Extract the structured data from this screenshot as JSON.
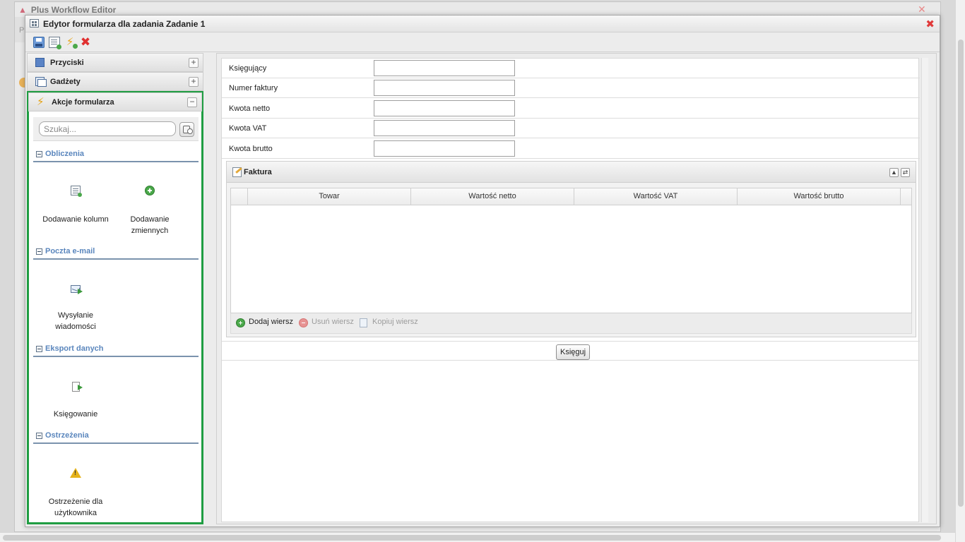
{
  "background_window": {
    "title": "Plus Workflow Editor",
    "menu_hint": "P"
  },
  "modal": {
    "title": "Edytor formularza dla zadania Zadanie 1",
    "close_icon": "close-icon"
  },
  "toolbar": {
    "buttons": [
      "save-icon",
      "add-form-field-icon",
      "add-action-icon",
      "delete-icon"
    ]
  },
  "left_panel": {
    "sections": [
      {
        "label": "Przyciski",
        "toggle": "+"
      },
      {
        "label": "Gadżety",
        "toggle": "+"
      },
      {
        "label": "Akcje formularza",
        "toggle": "−"
      }
    ],
    "search": {
      "placeholder": "Szukaj...",
      "value": ""
    },
    "categories": [
      {
        "label": "Obliczenia",
        "items": [
          {
            "label": "Dodawanie kolumn",
            "icon": "add-columns-icon"
          },
          {
            "label": "Dodawanie zmiennych",
            "icon": "add-variable-icon"
          }
        ]
      },
      {
        "label": "Poczta e-mail",
        "items": [
          {
            "label": "Wysyłanie wiadomości",
            "icon": "send-mail-icon"
          }
        ]
      },
      {
        "label": "Eksport danych",
        "items": [
          {
            "label": "Księgowanie",
            "icon": "export-icon"
          }
        ]
      },
      {
        "label": "Ostrzeżenia",
        "items": [
          {
            "label": "Ostrzeżenie dla użytkownika",
            "icon": "warning-icon"
          }
        ]
      }
    ]
  },
  "form": {
    "fields": [
      {
        "label": "Księgujący",
        "value": ""
      },
      {
        "label": "Numer faktury",
        "value": ""
      },
      {
        "label": "Kwota netto",
        "value": ""
      },
      {
        "label": "Kwota VAT",
        "value": ""
      },
      {
        "label": "Kwota brutto",
        "value": ""
      }
    ],
    "invoice_panel": {
      "title": "Faktura",
      "columns": [
        "Towar",
        "Wartość netto",
        "Wartość VAT",
        "Wartość brutto"
      ],
      "rows": [],
      "footer": {
        "add": "Dodaj wiersz",
        "remove": "Usuń wiersz",
        "copy": "Kopiuj wiersz"
      }
    },
    "submit_label": "Księguj"
  }
}
